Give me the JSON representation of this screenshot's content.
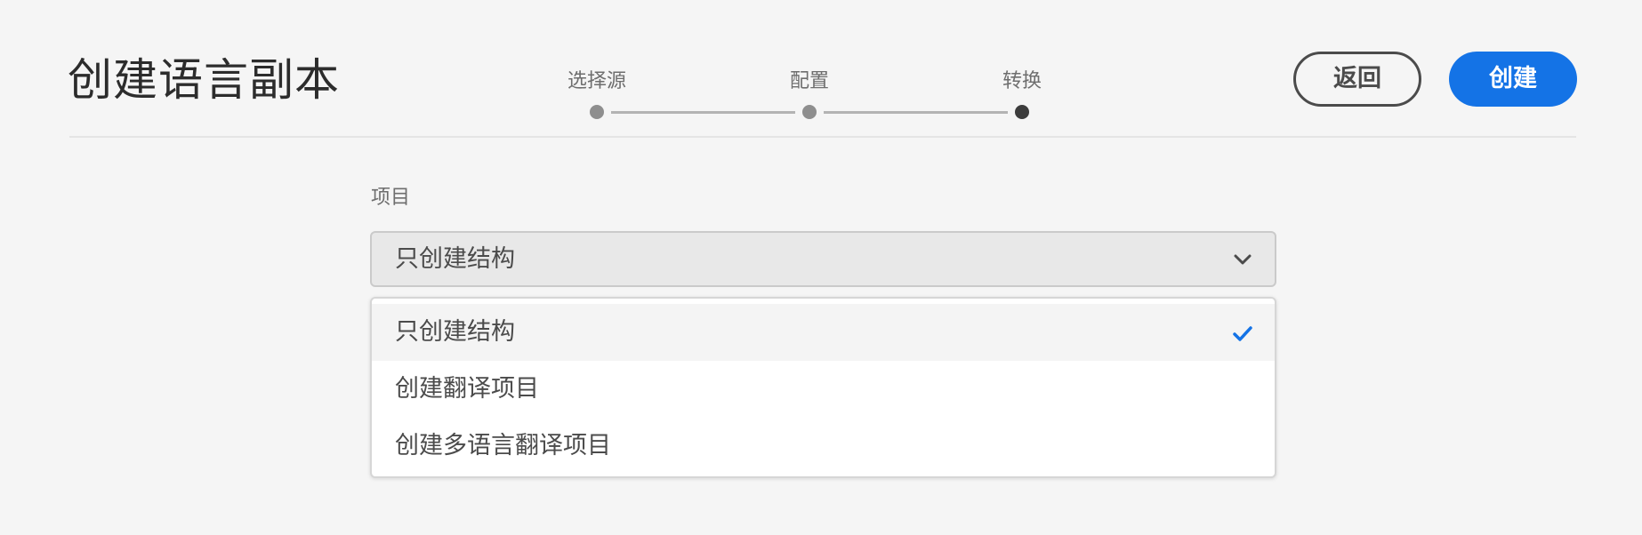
{
  "header": {
    "title": "创建语言副本"
  },
  "stepper": {
    "steps": [
      {
        "label": "选择源",
        "state": "done"
      },
      {
        "label": "配置",
        "state": "done"
      },
      {
        "label": "转换",
        "state": "current"
      }
    ]
  },
  "actions": {
    "back_label": "返回",
    "create_label": "创建"
  },
  "form": {
    "project_label": "项目",
    "project_select": {
      "value": "只创建结构",
      "options": [
        {
          "label": "只创建结构",
          "selected": true
        },
        {
          "label": "创建翻译项目",
          "selected": false
        },
        {
          "label": "创建多语言翻译项目",
          "selected": false
        }
      ]
    }
  },
  "icons": {
    "chevron": "chevron-down-icon",
    "check": "checkmark-icon"
  },
  "colors": {
    "accent": "#1473e6",
    "page_background": "#f5f5f5",
    "text": "#4b4b4b"
  }
}
